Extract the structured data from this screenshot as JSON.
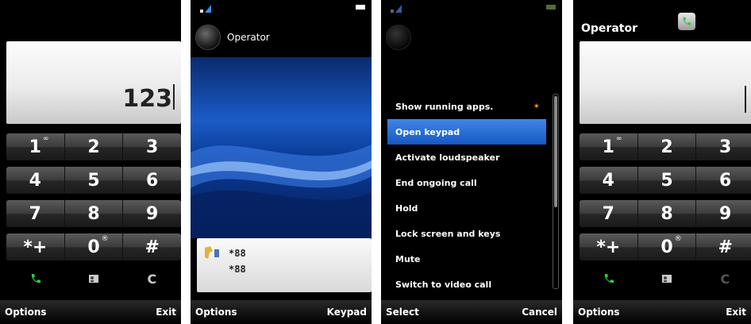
{
  "screens": [
    {
      "display_value": "123",
      "keypad": [
        [
          "1",
          "2",
          "3"
        ],
        [
          "4",
          "5",
          "6"
        ],
        [
          "7",
          "8",
          "9"
        ],
        [
          "*+",
          "0",
          "#"
        ]
      ],
      "key_sup": {
        "1": "∞",
        "0": "®"
      },
      "fn_c": "C",
      "softkeys": {
        "left": "Options",
        "right": "Exit"
      }
    },
    {
      "operator": "Operator",
      "call_numbers": [
        "*88",
        "*88"
      ],
      "softkeys": {
        "left": "Options",
        "right": "Keypad"
      }
    },
    {
      "menu": [
        "Show running apps.",
        "Open keypad",
        "Activate loudspeaker",
        "End ongoing call",
        "Hold",
        "Lock screen and keys",
        "Mute",
        "Switch to video call"
      ],
      "selected_index": 1,
      "softkeys": {
        "left": "Select",
        "right": "Cancel"
      }
    },
    {
      "operator": "Operator",
      "keypad": [
        [
          "1",
          "2",
          "3"
        ],
        [
          "4",
          "5",
          "6"
        ],
        [
          "7",
          "8",
          "9"
        ],
        [
          "*+",
          "0",
          "#"
        ]
      ],
      "fn_c": "C",
      "softkeys": {
        "left": "Options",
        "right": "Exit"
      }
    }
  ],
  "colors": {
    "selection": "#1f6fd9",
    "keypad_bg": "#333333",
    "display_bg": "#ececec"
  },
  "icons": {
    "call": "phone-green-icon",
    "contacts": "contact-card-icon",
    "signal": "signal-icon",
    "battery": "battery-icon"
  }
}
